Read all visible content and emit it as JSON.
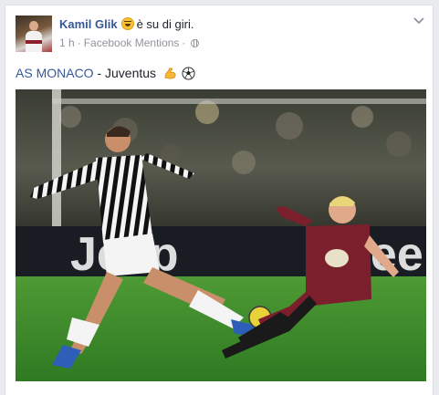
{
  "post": {
    "author_name": "Kamil Glik",
    "feeling_text": "è su di giri.",
    "timestamp": "1 h",
    "separator": "·",
    "source": "Facebook Mentions",
    "privacy_icon": "globe-icon",
    "menu_icon": "chevron-down-icon",
    "text_link": "AS MONACO",
    "text_rest": " - Juventus",
    "emojis": [
      "flexed-biceps-icon",
      "soccer-ball-icon"
    ],
    "photo": {
      "description_icon": "football-match-photo",
      "banner_text": "Jeep"
    }
  },
  "colors": {
    "link": "#365899",
    "meta": "#90949c",
    "text": "#1d2129",
    "card_border": "#dddfe2",
    "page_bg": "#e9ebee",
    "pitch": "#3f8a2c",
    "juve_stripe": "#111111",
    "torino_kit": "#7c1f2c"
  }
}
